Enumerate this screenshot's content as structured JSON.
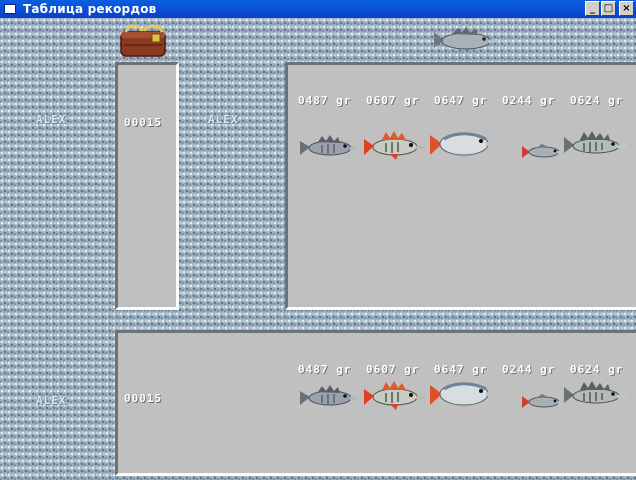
{
  "window": {
    "title": "Таблица рекордов",
    "minimize": "_",
    "maximize": "□",
    "close": "×"
  },
  "records": [
    {
      "name": "ALEX",
      "score": "00015",
      "catch": [
        {
          "weight": "0487 gr",
          "fish_icon": "perch-fish-icon"
        },
        {
          "weight": "0607 gr",
          "fish_icon": "red-perch-fish-icon"
        },
        {
          "weight": "0647 gr",
          "fish_icon": "bream-fish-icon"
        },
        {
          "weight": "0244 gr",
          "fish_icon": "roach-fish-icon"
        },
        {
          "weight": "0624 gr",
          "fish_icon": "pike-perch-fish-icon"
        }
      ]
    },
    {
      "name": "ALEX",
      "score": "00015",
      "catch": [
        {
          "weight": "0487 gr",
          "fish_icon": "perch-fish-icon"
        },
        {
          "weight": "0607 gr",
          "fish_icon": "red-perch-fish-icon"
        },
        {
          "weight": "0647 gr",
          "fish_icon": "bream-fish-icon"
        },
        {
          "weight": "0244 gr",
          "fish_icon": "roach-fish-icon"
        },
        {
          "weight": "0624 gr",
          "fish_icon": "pike-perch-fish-icon"
        }
      ]
    }
  ],
  "column_header_2_name": "ALEX",
  "header_icons": [
    "bag-icon",
    "fish-header-icon"
  ],
  "colors": {
    "panel": "#c0c0c0",
    "title_bar": "#0b4fd4",
    "texture": "#9fb2c3"
  }
}
